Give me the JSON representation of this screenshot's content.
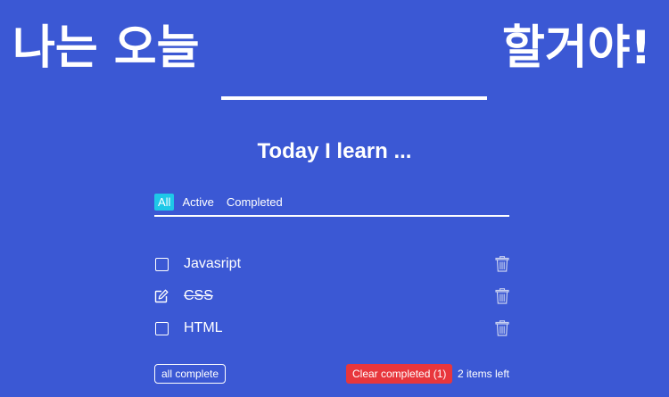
{
  "hero": {
    "left_text": "나는 오늘",
    "right_text": "할거야!"
  },
  "title": "Today I learn ...",
  "tabs": [
    {
      "label": "All",
      "active": true
    },
    {
      "label": "Active",
      "active": false
    },
    {
      "label": "Completed",
      "active": false
    }
  ],
  "todos": [
    {
      "text": "Javasript",
      "completed": false,
      "icon": "checkbox-icon"
    },
    {
      "text": "CSS",
      "completed": true,
      "icon": "edit-icon"
    },
    {
      "text": "HTML",
      "completed": false,
      "icon": "checkbox-icon"
    }
  ],
  "footer": {
    "all_complete_label": "all complete",
    "clear_completed_label": "Clear completed (1)",
    "items_left": "2 items left"
  },
  "colors": {
    "background": "#3b58d4",
    "active_tab": "#1ec8e8",
    "clear_button": "#e8363c"
  }
}
